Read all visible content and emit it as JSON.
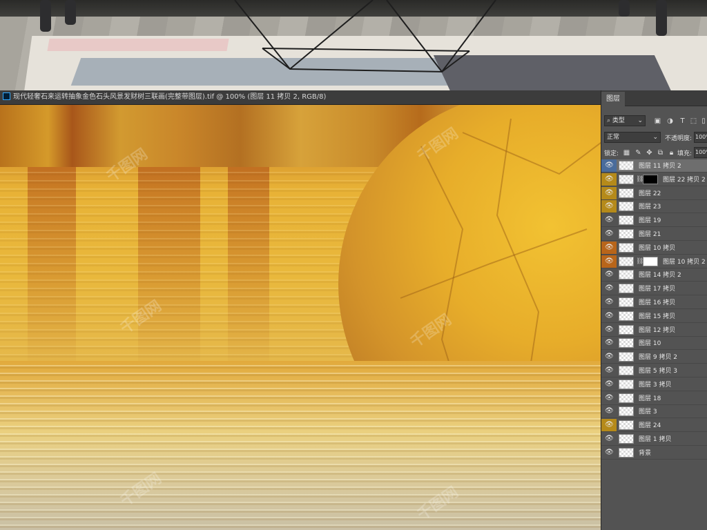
{
  "document": {
    "title": "现代轻奢石来运转抽象金色石头风景发财树三联画(完整带图层).tif @ 100% (图层 11 拷贝 2, RGB/8)"
  },
  "watermark_text": "千图网",
  "panel": {
    "tab_label": "图层",
    "filter_kind": "类型",
    "blend_mode": "正常",
    "opacity_label": "不透明度:",
    "opacity_value": "100%",
    "lock_label": "锁定:",
    "fill_label": "填充:",
    "fill_value": "100%",
    "layers": [
      {
        "name": "图层 11 拷贝 2",
        "selected": true,
        "eye_bg": "#4a6c9b",
        "mask": false
      },
      {
        "name": "图层 22 拷贝 2",
        "selected": false,
        "eye_bg": "#b58a1a",
        "mask": true,
        "mask_color": "#000000"
      },
      {
        "name": "图层 22",
        "selected": false,
        "eye_bg": "#b58a1a",
        "mask": false
      },
      {
        "name": "图层 23",
        "selected": false,
        "eye_bg": "#b58a1a",
        "mask": false
      },
      {
        "name": "图层 19",
        "selected": false,
        "eye_bg": "",
        "mask": false
      },
      {
        "name": "图层 21",
        "selected": false,
        "eye_bg": "",
        "mask": false
      },
      {
        "name": "图层 10 拷贝",
        "selected": false,
        "eye_bg": "#b8651a",
        "mask": false
      },
      {
        "name": "图层 10 拷贝 2",
        "selected": false,
        "eye_bg": "#b8651a",
        "mask": true,
        "mask_color": "#ffffff"
      },
      {
        "name": "图层 14 拷贝 2",
        "selected": false,
        "eye_bg": "",
        "mask": false
      },
      {
        "name": "图层 17 拷贝",
        "selected": false,
        "eye_bg": "",
        "mask": false
      },
      {
        "name": "图层 16 拷贝",
        "selected": false,
        "eye_bg": "",
        "mask": false
      },
      {
        "name": "图层 15 拷贝",
        "selected": false,
        "eye_bg": "",
        "mask": false
      },
      {
        "name": "图层 12 拷贝",
        "selected": false,
        "eye_bg": "",
        "mask": false
      },
      {
        "name": "图层 10",
        "selected": false,
        "eye_bg": "",
        "mask": false
      },
      {
        "name": "图层 9 拷贝 2",
        "selected": false,
        "eye_bg": "",
        "mask": false
      },
      {
        "name": "图层 5 拷贝 3",
        "selected": false,
        "eye_bg": "",
        "mask": false
      },
      {
        "name": "图层 3 拷贝",
        "selected": false,
        "eye_bg": "",
        "mask": false
      },
      {
        "name": "图层 18",
        "selected": false,
        "eye_bg": "",
        "mask": false
      },
      {
        "name": "图层 3",
        "selected": false,
        "eye_bg": "",
        "mask": false
      },
      {
        "name": "图层 24",
        "selected": false,
        "eye_bg": "#b58a1a",
        "mask": false
      },
      {
        "name": "图层 1 拷贝",
        "selected": false,
        "eye_bg": "",
        "mask": false
      },
      {
        "name": "背景",
        "selected": false,
        "eye_bg": "",
        "mask": false
      }
    ]
  }
}
